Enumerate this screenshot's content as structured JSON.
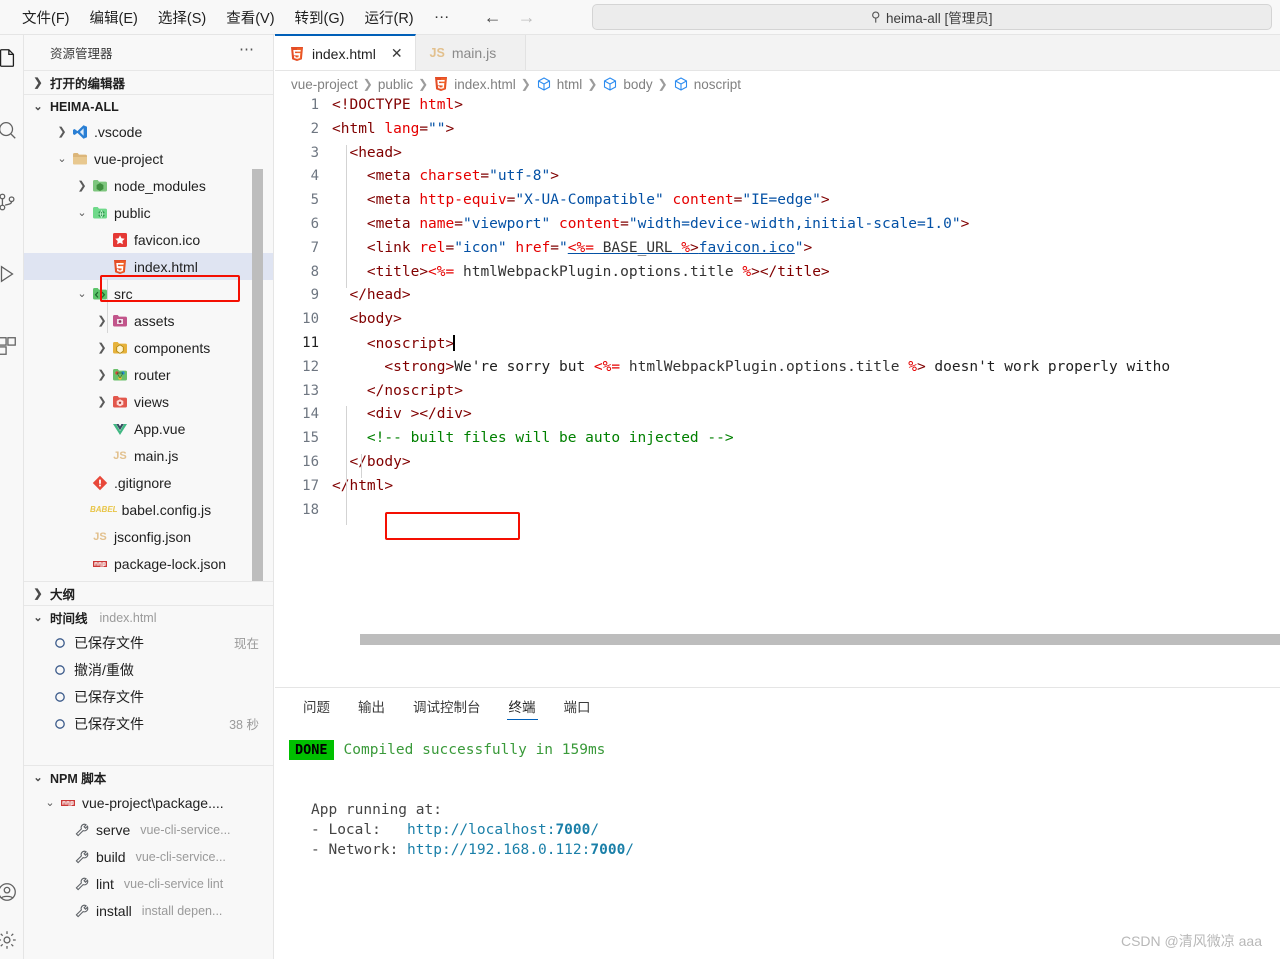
{
  "titlebar": {
    "menus": [
      "文件(F)",
      "编辑(E)",
      "选择(S)",
      "查看(V)",
      "转到(G)",
      "运行(R)"
    ],
    "more": "…",
    "back_arrow": "←",
    "forward_arrow": "→",
    "search_value": "heima-all [管理员]",
    "search_icon": "search-icon"
  },
  "activitybar": {
    "items": [
      {
        "name": "explorer-icon",
        "active": true
      },
      {
        "name": "search-icon",
        "active": false
      },
      {
        "name": "source-control-icon",
        "active": false
      },
      {
        "name": "run-debug-icon",
        "active": false
      },
      {
        "name": "extensions-icon",
        "active": false
      }
    ],
    "bottom": [
      {
        "name": "account-icon"
      },
      {
        "name": "gear-icon"
      }
    ]
  },
  "sidebar": {
    "title": "资源管理器",
    "more_label": "⋯",
    "open_editors": {
      "label": "打开的编辑器",
      "twisty": "❯"
    },
    "workspace": {
      "label": "HEIMA-ALL",
      "twisty": "⌄"
    },
    "tree": [
      {
        "label": ".vscode",
        "indent": 1,
        "twisty": "❯",
        "icon": "vscode-folder-icon",
        "selected": false
      },
      {
        "label": "vue-project",
        "indent": 1,
        "twisty": "⌄",
        "icon": "folder-open-icon",
        "selected": false
      },
      {
        "label": "node_modules",
        "indent": 2,
        "twisty": "❯",
        "icon": "node-folder-icon",
        "selected": false
      },
      {
        "label": "public",
        "indent": 2,
        "twisty": "⌄",
        "icon": "public-folder-icon",
        "selected": false
      },
      {
        "label": "favicon.ico",
        "indent": 3,
        "twisty": "",
        "icon": "favicon-icon",
        "selected": false
      },
      {
        "label": "index.html",
        "indent": 3,
        "twisty": "",
        "icon": "html5-icon",
        "selected": true
      },
      {
        "label": "src",
        "indent": 2,
        "twisty": "⌄",
        "icon": "src-folder-icon",
        "selected": false
      },
      {
        "label": "assets",
        "indent": 3,
        "twisty": "❯",
        "icon": "assets-folder-icon",
        "selected": false
      },
      {
        "label": "components",
        "indent": 3,
        "twisty": "❯",
        "icon": "components-folder-icon",
        "selected": false
      },
      {
        "label": "router",
        "indent": 3,
        "twisty": "❯",
        "icon": "router-folder-icon",
        "selected": false
      },
      {
        "label": "views",
        "indent": 3,
        "twisty": "❯",
        "icon": "views-folder-icon",
        "selected": false
      },
      {
        "label": "App.vue",
        "indent": 3,
        "twisty": "",
        "icon": "vue-icon",
        "selected": false
      },
      {
        "label": "main.js",
        "indent": 3,
        "twisty": "",
        "icon": "js-icon",
        "selected": false
      },
      {
        "label": ".gitignore",
        "indent": 2,
        "twisty": "",
        "icon": "git-icon",
        "selected": false
      },
      {
        "label": "babel.config.js",
        "indent": 2,
        "twisty": "",
        "icon": "babel-icon",
        "selected": false
      },
      {
        "label": "jsconfig.json",
        "indent": 2,
        "twisty": "",
        "icon": "jsconfig-icon",
        "selected": false
      },
      {
        "label": "package-lock.json",
        "indent": 2,
        "twisty": "",
        "icon": "npm-icon",
        "selected": false
      }
    ],
    "outline": {
      "label": "大纲",
      "twisty": "❯"
    },
    "timeline": {
      "label": "时间线",
      "file": "index.html",
      "twisty": "⌄"
    },
    "timeline_items": [
      {
        "label": "已保存文件",
        "time": "现在"
      },
      {
        "label": "撤消/重做",
        "time": ""
      },
      {
        "label": "已保存文件",
        "time": ""
      },
      {
        "label": "已保存文件",
        "time": "38 秒"
      }
    ],
    "npm": {
      "label": "NPM 脚本",
      "twisty": "⌄"
    },
    "npm_package": {
      "label": "vue-project\\package....",
      "twisty": "⌄",
      "icon": "npm-icon"
    },
    "npm_scripts": [
      {
        "name": "serve",
        "cmd": "vue-cli-service..."
      },
      {
        "name": "build",
        "cmd": "vue-cli-service..."
      },
      {
        "name": "lint",
        "cmd": "vue-cli-service lint"
      },
      {
        "name": "install",
        "cmd": "install depen..."
      }
    ]
  },
  "editor": {
    "tabs": [
      {
        "label": "index.html",
        "icon": "html5-icon",
        "active": true,
        "close": "✕"
      },
      {
        "label": "main.js",
        "icon": "js-icon",
        "active": false,
        "close": ""
      }
    ],
    "breadcrumb": [
      {
        "label": "vue-project",
        "icon": ""
      },
      {
        "label": "public",
        "icon": ""
      },
      {
        "label": "index.html",
        "icon": "html5-icon"
      },
      {
        "label": "html",
        "icon": "symbol-cube-icon"
      },
      {
        "label": "body",
        "icon": "symbol-cube-icon"
      },
      {
        "label": "noscript",
        "icon": "symbol-cube-icon"
      }
    ],
    "breadcrumb_sep": "❯",
    "lines": [
      {
        "n": "1",
        "cur": false
      },
      {
        "n": "2",
        "cur": false
      },
      {
        "n": "3",
        "cur": false
      },
      {
        "n": "4",
        "cur": false
      },
      {
        "n": "5",
        "cur": false
      },
      {
        "n": "6",
        "cur": false
      },
      {
        "n": "7",
        "cur": false
      },
      {
        "n": "8",
        "cur": false
      },
      {
        "n": "9",
        "cur": false
      },
      {
        "n": "10",
        "cur": false
      },
      {
        "n": "11",
        "cur": true
      },
      {
        "n": "12",
        "cur": false
      },
      {
        "n": "13",
        "cur": false
      },
      {
        "n": "14",
        "cur": false
      },
      {
        "n": "15",
        "cur": false
      },
      {
        "n": "16",
        "cur": false
      },
      {
        "n": "17",
        "cur": false
      },
      {
        "n": "18",
        "cur": false
      }
    ],
    "code_text": [
      "<!DOCTYPE html>",
      "<html lang=\"\">",
      "  <head>",
      "    <meta charset=\"utf-8\">",
      "    <meta http-equiv=\"X-UA-Compatible\" content=\"IE=edge\">",
      "    <meta name=\"viewport\" content=\"width=device-width,initial-scale=1.0\">",
      "    <link rel=\"icon\" href=\"<%= BASE_URL %>favicon.ico\">",
      "    <title><%= htmlWebpackPlugin.options.title %></title>",
      "  </head>",
      "  <body>",
      "    <noscript>",
      "      <strong>We're sorry but <%= htmlWebpackPlugin.options.title %> doesn't work properly witho",
      "    </noscript>",
      "    <div ></div>",
      "    <!-- built files will be auto injected -->",
      "  </body>",
      "</html>",
      ""
    ]
  },
  "panel": {
    "tabs": [
      {
        "label": "问题",
        "active": false
      },
      {
        "label": "输出",
        "active": false
      },
      {
        "label": "调试控制台",
        "active": false
      },
      {
        "label": "终端",
        "active": true
      },
      {
        "label": "端口",
        "active": false
      }
    ],
    "terminal": {
      "badge": "DONE",
      "compiled": "Compiled successfully in 159ms",
      "app_running": "App running at:",
      "local_label": "- Local:",
      "local_url_pre": "http://localhost:",
      "local_port": "7000",
      "local_url_post": "/",
      "network_label": "- Network:",
      "network_url_pre": "http://192.168.0.112:",
      "network_port": "7000",
      "network_url_post": "/"
    }
  },
  "watermark": "CSDN @清风微凉 aaa",
  "colors": {
    "accent": "#005fb8",
    "highlight_box": "#f40f02",
    "selection": "#dfe4f2",
    "done_green": "#00c000"
  }
}
